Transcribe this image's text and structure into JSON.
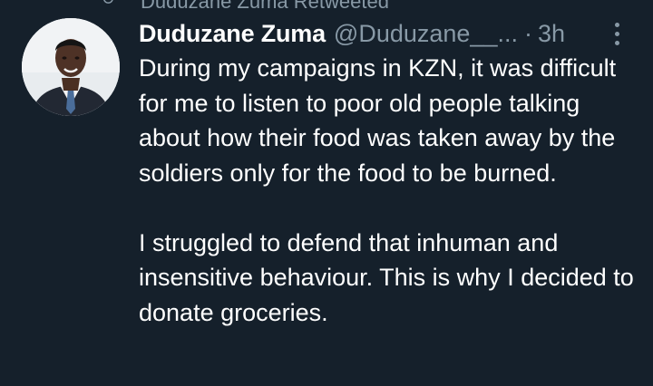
{
  "retweet": {
    "label": "Duduzane Zuma Retweeted",
    "icon": "retweet-icon"
  },
  "tweet": {
    "author_name": "Duduzane Zuma",
    "author_handle": "@Duduzane__...",
    "separator": "·",
    "time": "3h",
    "avatar_icon": "profile-photo",
    "more_icon": "vertical-ellipsis-icon",
    "paragraphs": [
      "During my campaigns in KZN, it was difficult for me to listen to poor old people talking about how their food was taken away by the soldiers only for the food to be burned.",
      "I struggled to defend that inhuman and insensitive behaviour. This is why I decided to donate groceries."
    ]
  },
  "colors": {
    "background": "#15202b",
    "primary_text": "#ffffff",
    "secondary_text": "#8899a6"
  }
}
